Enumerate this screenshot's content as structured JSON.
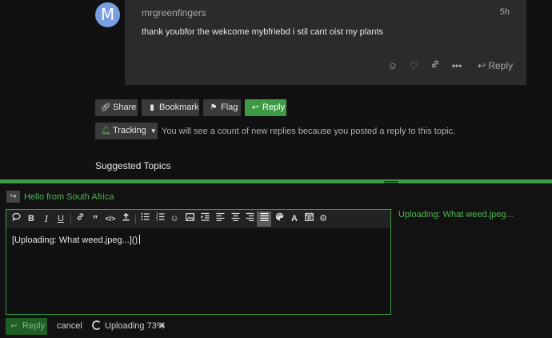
{
  "post": {
    "avatar_letter": "M",
    "username": "mrgreenfingers",
    "time": "5h",
    "body": "thank youbfor the wekcome mybfriebd i stil cant oist my plants",
    "reply_label": "Reply"
  },
  "topic_controls": {
    "share_label": "Share",
    "bookmark_label": "Bookmark",
    "flag_label": "Flag",
    "reply_label": "Reply",
    "tracking_label": "Tracking",
    "tracking_description": "You will see a count of new replies because you posted a reply to this topic."
  },
  "suggested_topics_heading": "Suggested Topics",
  "composer": {
    "reply_to_title": "Hello from South Africa",
    "editor_text": "[Uploading: What weed.jpeg...]()",
    "preview_text": "Uploading: What weed.jpeg...",
    "submit_label": "Reply",
    "cancel_label": "cancel",
    "upload_status": "Uploading 73%",
    "upload_progress_percent": 73,
    "upload_cancel_symbol": "✕"
  },
  "colors": {
    "accent_green": "#3e9a45",
    "link_green": "#4fb54f",
    "background": "#111111",
    "card": "#2b2b2b"
  }
}
